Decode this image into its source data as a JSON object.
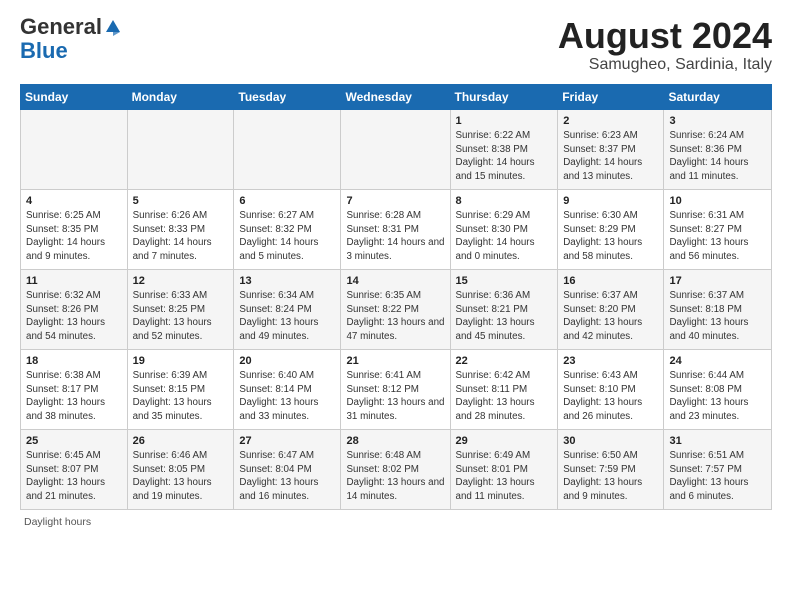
{
  "header": {
    "logo_general": "General",
    "logo_blue": "Blue",
    "title": "August 2024",
    "location": "Samugheo, Sardinia, Italy"
  },
  "footer": {
    "label": "Daylight hours"
  },
  "days_of_week": [
    "Sunday",
    "Monday",
    "Tuesday",
    "Wednesday",
    "Thursday",
    "Friday",
    "Saturday"
  ],
  "weeks": [
    [
      {
        "day": "",
        "info": ""
      },
      {
        "day": "",
        "info": ""
      },
      {
        "day": "",
        "info": ""
      },
      {
        "day": "",
        "info": ""
      },
      {
        "day": "1",
        "info": "Sunrise: 6:22 AM\nSunset: 8:38 PM\nDaylight: 14 hours and 15 minutes."
      },
      {
        "day": "2",
        "info": "Sunrise: 6:23 AM\nSunset: 8:37 PM\nDaylight: 14 hours and 13 minutes."
      },
      {
        "day": "3",
        "info": "Sunrise: 6:24 AM\nSunset: 8:36 PM\nDaylight: 14 hours and 11 minutes."
      }
    ],
    [
      {
        "day": "4",
        "info": "Sunrise: 6:25 AM\nSunset: 8:35 PM\nDaylight: 14 hours and 9 minutes."
      },
      {
        "day": "5",
        "info": "Sunrise: 6:26 AM\nSunset: 8:33 PM\nDaylight: 14 hours and 7 minutes."
      },
      {
        "day": "6",
        "info": "Sunrise: 6:27 AM\nSunset: 8:32 PM\nDaylight: 14 hours and 5 minutes."
      },
      {
        "day": "7",
        "info": "Sunrise: 6:28 AM\nSunset: 8:31 PM\nDaylight: 14 hours and 3 minutes."
      },
      {
        "day": "8",
        "info": "Sunrise: 6:29 AM\nSunset: 8:30 PM\nDaylight: 14 hours and 0 minutes."
      },
      {
        "day": "9",
        "info": "Sunrise: 6:30 AM\nSunset: 8:29 PM\nDaylight: 13 hours and 58 minutes."
      },
      {
        "day": "10",
        "info": "Sunrise: 6:31 AM\nSunset: 8:27 PM\nDaylight: 13 hours and 56 minutes."
      }
    ],
    [
      {
        "day": "11",
        "info": "Sunrise: 6:32 AM\nSunset: 8:26 PM\nDaylight: 13 hours and 54 minutes."
      },
      {
        "day": "12",
        "info": "Sunrise: 6:33 AM\nSunset: 8:25 PM\nDaylight: 13 hours and 52 minutes."
      },
      {
        "day": "13",
        "info": "Sunrise: 6:34 AM\nSunset: 8:24 PM\nDaylight: 13 hours and 49 minutes."
      },
      {
        "day": "14",
        "info": "Sunrise: 6:35 AM\nSunset: 8:22 PM\nDaylight: 13 hours and 47 minutes."
      },
      {
        "day": "15",
        "info": "Sunrise: 6:36 AM\nSunset: 8:21 PM\nDaylight: 13 hours and 45 minutes."
      },
      {
        "day": "16",
        "info": "Sunrise: 6:37 AM\nSunset: 8:20 PM\nDaylight: 13 hours and 42 minutes."
      },
      {
        "day": "17",
        "info": "Sunrise: 6:37 AM\nSunset: 8:18 PM\nDaylight: 13 hours and 40 minutes."
      }
    ],
    [
      {
        "day": "18",
        "info": "Sunrise: 6:38 AM\nSunset: 8:17 PM\nDaylight: 13 hours and 38 minutes."
      },
      {
        "day": "19",
        "info": "Sunrise: 6:39 AM\nSunset: 8:15 PM\nDaylight: 13 hours and 35 minutes."
      },
      {
        "day": "20",
        "info": "Sunrise: 6:40 AM\nSunset: 8:14 PM\nDaylight: 13 hours and 33 minutes."
      },
      {
        "day": "21",
        "info": "Sunrise: 6:41 AM\nSunset: 8:12 PM\nDaylight: 13 hours and 31 minutes."
      },
      {
        "day": "22",
        "info": "Sunrise: 6:42 AM\nSunset: 8:11 PM\nDaylight: 13 hours and 28 minutes."
      },
      {
        "day": "23",
        "info": "Sunrise: 6:43 AM\nSunset: 8:10 PM\nDaylight: 13 hours and 26 minutes."
      },
      {
        "day": "24",
        "info": "Sunrise: 6:44 AM\nSunset: 8:08 PM\nDaylight: 13 hours and 23 minutes."
      }
    ],
    [
      {
        "day": "25",
        "info": "Sunrise: 6:45 AM\nSunset: 8:07 PM\nDaylight: 13 hours and 21 minutes."
      },
      {
        "day": "26",
        "info": "Sunrise: 6:46 AM\nSunset: 8:05 PM\nDaylight: 13 hours and 19 minutes."
      },
      {
        "day": "27",
        "info": "Sunrise: 6:47 AM\nSunset: 8:04 PM\nDaylight: 13 hours and 16 minutes."
      },
      {
        "day": "28",
        "info": "Sunrise: 6:48 AM\nSunset: 8:02 PM\nDaylight: 13 hours and 14 minutes."
      },
      {
        "day": "29",
        "info": "Sunrise: 6:49 AM\nSunset: 8:01 PM\nDaylight: 13 hours and 11 minutes."
      },
      {
        "day": "30",
        "info": "Sunrise: 6:50 AM\nSunset: 7:59 PM\nDaylight: 13 hours and 9 minutes."
      },
      {
        "day": "31",
        "info": "Sunrise: 6:51 AM\nSunset: 7:57 PM\nDaylight: 13 hours and 6 minutes."
      }
    ]
  ]
}
